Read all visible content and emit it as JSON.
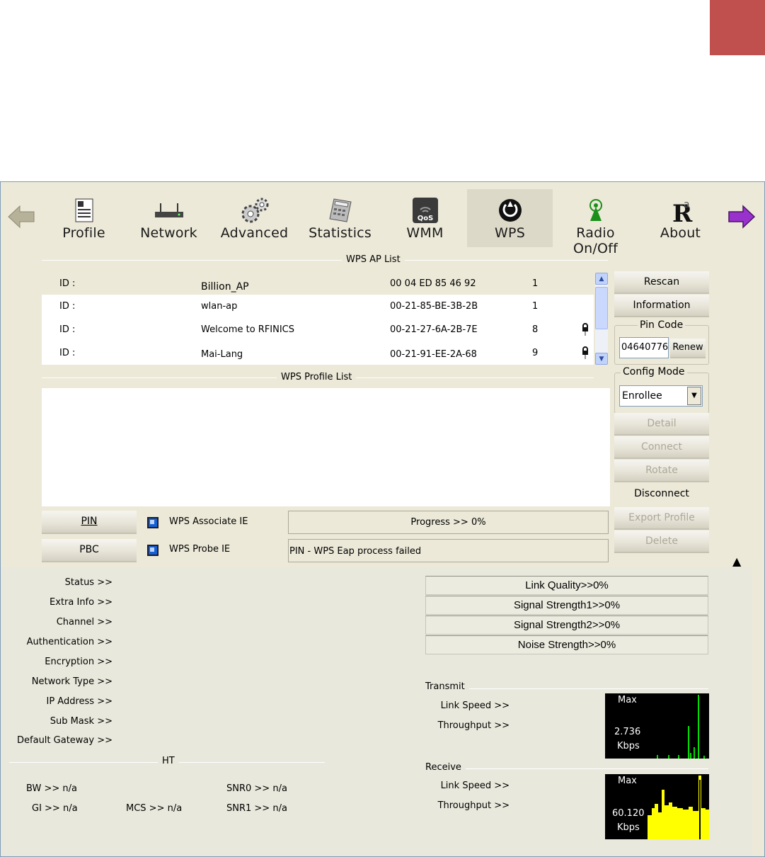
{
  "toolbar": {
    "items": [
      {
        "label": "Profile",
        "icon": "profile-icon"
      },
      {
        "label": "Network",
        "icon": "network-icon"
      },
      {
        "label": "Advanced",
        "icon": "advanced-gears-icon"
      },
      {
        "label": "Statistics",
        "icon": "statistics-calculator-icon"
      },
      {
        "label": "WMM",
        "icon": "wmm-qos-icon"
      },
      {
        "label": "WPS",
        "icon": "wps-icon"
      },
      {
        "label": "Radio On/Off",
        "icon": "radio-antenna-icon"
      },
      {
        "label": "About",
        "icon": "about-r-icon"
      }
    ],
    "active": "WPS"
  },
  "wps_ap_list": {
    "title": "WPS AP List",
    "rows": [
      {
        "id": "ID :",
        "ssid": "Billion_AP",
        "bssid": "00 04 ED 85 46 92",
        "channel": "1",
        "locked": false
      },
      {
        "id": "ID :",
        "ssid": "wlan-ap",
        "bssid": "00-21-85-BE-3B-2B",
        "channel": "1",
        "locked": false
      },
      {
        "id": "ID :",
        "ssid": "Welcome to RFINICS",
        "bssid": "00-21-27-6A-2B-7E",
        "channel": "8",
        "locked": true
      },
      {
        "id": "ID :",
        "ssid": "Mai-Lang",
        "bssid": "00-21-91-EE-2A-68",
        "channel": "9",
        "locked": true
      }
    ]
  },
  "wps_profile_list": {
    "title": "WPS Profile List"
  },
  "side": {
    "rescan": "Rescan",
    "information": "Information",
    "pin_code_title": "Pin Code",
    "pin_code": "04640776",
    "renew": "Renew",
    "config_mode_title": "Config Mode",
    "config_mode": "Enrollee",
    "detail": "Detail",
    "connect": "Connect",
    "rotate": "Rotate",
    "disconnect": "Disconnect",
    "export_profile": "Export Profile",
    "delete": "Delete"
  },
  "bottom_controls": {
    "pin": "PIN",
    "pbc": "PBC",
    "wps_associate_ie": "WPS Associate IE",
    "wps_probe_ie": "WPS Probe IE",
    "progress": "Progress >> 0%",
    "message": "PIN - WPS Eap process failed"
  },
  "status_panel": {
    "labels": {
      "status": "Status >>",
      "extra_info": "Extra Info >>",
      "channel": "Channel >>",
      "authentication": "Authentication >>",
      "encryption": "Encryption >>",
      "network_type": "Network Type >>",
      "ip_address": "IP Address >>",
      "sub_mask": "Sub Mask >>",
      "default_gateway": "Default Gateway >>"
    },
    "ht": {
      "title": "HT",
      "bw": "BW >> n/a",
      "gi": "GI >> n/a",
      "mcs": "MCS >> n/a",
      "snr0": "SNR0 >> n/a",
      "snr1": "SNR1 >> n/a"
    },
    "meters": {
      "link_quality": "Link Quality>>0%",
      "signal1": "Signal Strength1>>0%",
      "signal2": "Signal Strength2>>0%",
      "noise": "Noise Strength>>0%"
    },
    "transmit": {
      "title": "Transmit",
      "link_speed": "Link Speed >>",
      "throughput": "Throughput >>",
      "graph_max": "Max",
      "graph_value": "2.736",
      "graph_unit": "Kbps",
      "graph_color": "#00dd00"
    },
    "receive": {
      "title": "Receive",
      "link_speed": "Link Speed >>",
      "throughput": "Throughput >>",
      "graph_max": "Max",
      "graph_value": "60.120",
      "graph_unit": "Kbps",
      "graph_color": "#ffff00"
    }
  }
}
